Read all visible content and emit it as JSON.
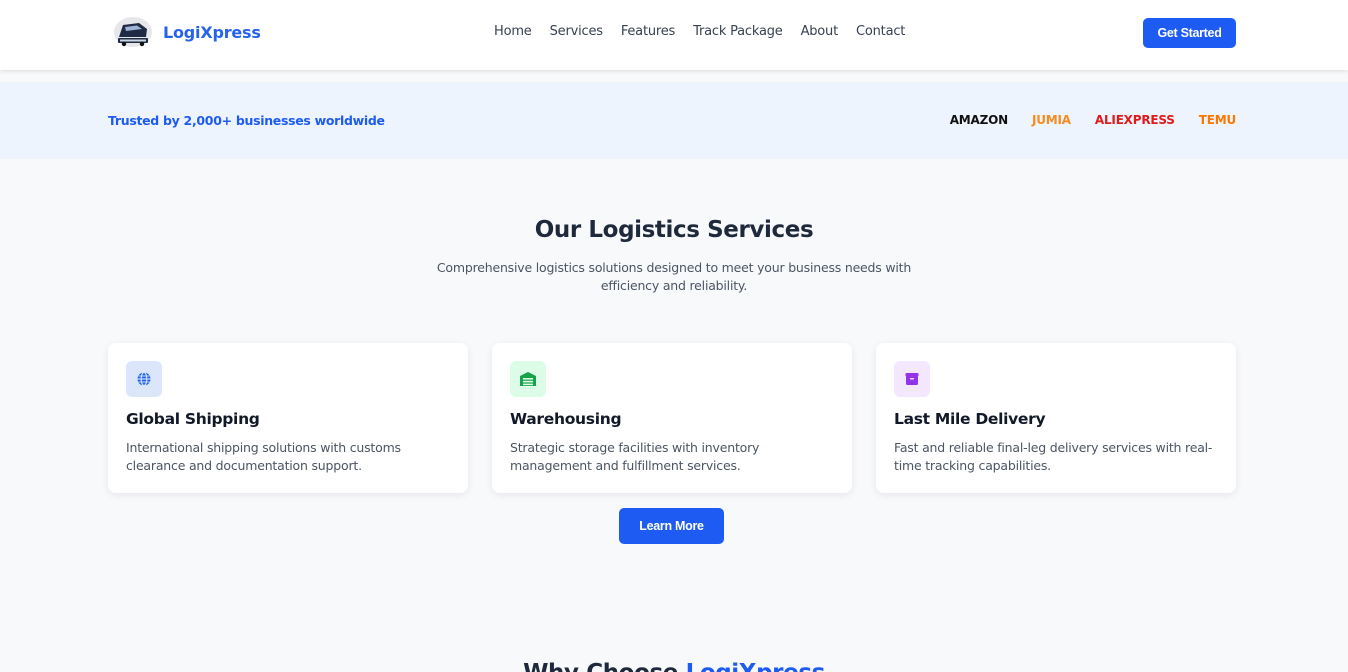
{
  "header": {
    "logo_text": "LogiXpress",
    "nav": [
      "Home",
      "Services",
      "Features",
      "Track Package",
      "About",
      "Contact"
    ],
    "cta_label": "Get Started"
  },
  "trust": {
    "text": "Trusted by 2,000+ businesses worldwide",
    "brands": [
      {
        "name": "AMAZON",
        "color": "#111111"
      },
      {
        "name": "JUMIA",
        "color": "#f68b1e"
      },
      {
        "name": "ALIEXPRESS",
        "color": "#e01b1b"
      },
      {
        "name": "TEMU",
        "color": "#fb7701"
      }
    ]
  },
  "services": {
    "title": "Our Logistics Services",
    "subtitle": "Comprehensive logistics solutions designed to meet your business needs with efficiency and reliability.",
    "cards": [
      {
        "icon": "globe-icon",
        "icon_bg": "#dbe6fb",
        "icon_color": "#2563eb",
        "title": "Global Shipping",
        "desc": "International shipping solutions with customs clearance and documentation support."
      },
      {
        "icon": "warehouse-icon",
        "icon_bg": "#dcfce7",
        "icon_color": "#16a34a",
        "title": "Warehousing",
        "desc": "Strategic storage facilities with inventory management and fulfillment services."
      },
      {
        "icon": "box-icon",
        "icon_bg": "#f3e8ff",
        "icon_color": "#9333ea",
        "title": "Last Mile Delivery",
        "desc": "Fast and reliable final-leg delivery services with real-time tracking capabilities."
      }
    ],
    "learn_more": "Learn More"
  },
  "next_section": {
    "title_prefix": "Why Choose ",
    "title_accent": "LogiXpress"
  }
}
